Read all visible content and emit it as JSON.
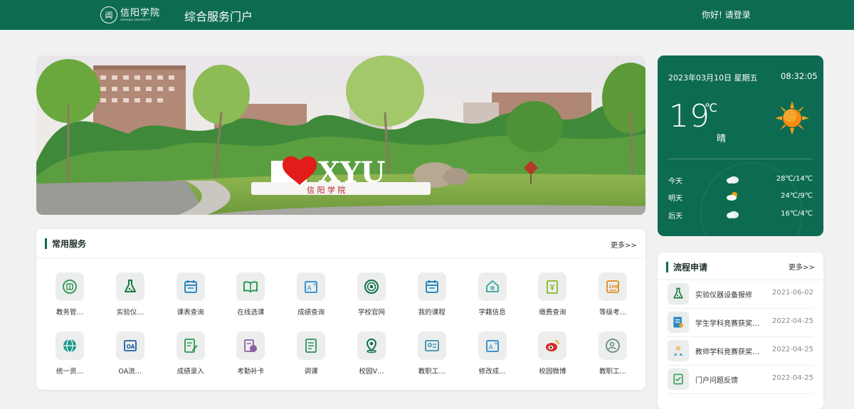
{
  "header": {
    "logo_cn": "信阳学院",
    "logo_en": "XINYANG UNIVERSITY",
    "portal_title": "综合服务门户",
    "greeting": "你好!",
    "login_label": "请登录"
  },
  "banner": {
    "sign_text": "I ♥ XYU",
    "plate_text": "信 阳 学 院"
  },
  "services": {
    "title": "常用服务",
    "more": "更多>>",
    "items": [
      {
        "label": "教务管…",
        "icon": "book-icon",
        "color": "#3a9c5f"
      },
      {
        "label": "实验仪…",
        "icon": "flask-icon",
        "color": "#1a7a3f"
      },
      {
        "label": "课表查询",
        "icon": "calendar-icon",
        "color": "#2a88c8"
      },
      {
        "label": "在线选课",
        "icon": "open-book-icon",
        "color": "#2f9a55"
      },
      {
        "label": "成绩查询",
        "icon": "grade-icon",
        "color": "#2a88c8"
      },
      {
        "label": "学校官网",
        "icon": "school-seal-icon",
        "color": "#13704b"
      },
      {
        "label": "我的课程",
        "icon": "calendar-icon",
        "color": "#2a88c8"
      },
      {
        "label": "学籍信息",
        "icon": "home-icon",
        "color": "#33a3a0"
      },
      {
        "label": "缴费查询",
        "icon": "payment-icon",
        "color": "#8bb82a"
      },
      {
        "label": "等级考…",
        "icon": "score-100-icon",
        "color": "#e08a1e"
      },
      {
        "label": "统一资…",
        "icon": "globe-icon",
        "color": "#1f9a8c"
      },
      {
        "label": "OA流…",
        "icon": "oa-icon",
        "color": "#1f5fa8"
      },
      {
        "label": "成绩录入",
        "icon": "edit-icon",
        "color": "#2e9a52"
      },
      {
        "label": "考勤补卡",
        "icon": "attendance-icon",
        "color": "#8a5fa8"
      },
      {
        "label": "调课",
        "icon": "document-icon",
        "color": "#2f8f5f"
      },
      {
        "label": "校园V…",
        "icon": "location-pin-icon",
        "color": "#13704b"
      },
      {
        "label": "教职工…",
        "icon": "id-card-icon",
        "color": "#3a8fb0"
      },
      {
        "label": "修改成…",
        "icon": "grade-edit-icon",
        "color": "#2a88c8"
      },
      {
        "label": "校园微博",
        "icon": "weibo-icon",
        "color": "#d62a2a"
      },
      {
        "label": "教职工…",
        "icon": "user-clock-icon",
        "color": "#6a8a7a"
      }
    ]
  },
  "weather": {
    "date": "2023年03月10日 星期五",
    "time": "08:32:05",
    "temp": "19",
    "unit": "℃",
    "condition": "晴",
    "forecast": [
      {
        "day": "今天",
        "range": "28℃/14℃",
        "icon": "cloudy-icon"
      },
      {
        "day": "明天",
        "range": "24℃/9℃",
        "icon": "partly-cloudy-icon"
      },
      {
        "day": "后天",
        "range": "16℃/4℃",
        "icon": "cloudy-icon"
      }
    ]
  },
  "flow": {
    "title": "流程申请",
    "more": "更多>>",
    "items": [
      {
        "name": "实验仪器设备报修",
        "date": "2021-06-02",
        "icon": "flask-icon"
      },
      {
        "name": "学生学科竞赛获奖…",
        "date": "2022-04-25",
        "icon": "certificate-icon"
      },
      {
        "name": "教师学科竞赛获奖…",
        "date": "2022-04-25",
        "icon": "teacher-award-icon"
      },
      {
        "name": "门户问题反馈",
        "date": "2022-04-25",
        "icon": "feedback-icon"
      }
    ]
  }
}
